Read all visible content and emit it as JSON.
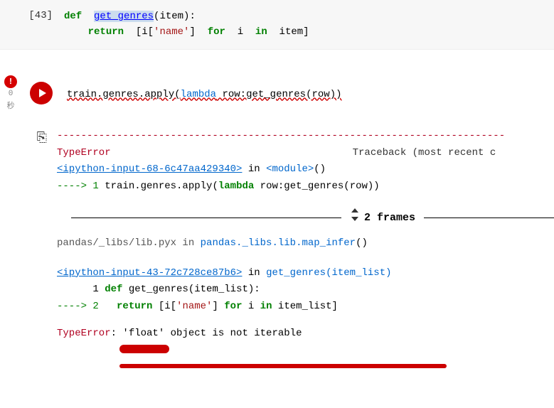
{
  "cell1": {
    "prompt": "[43]",
    "line1_def": "def",
    "line1_fn": "get_genres",
    "line1_args": "(item):",
    "line2_indent": "    ",
    "line2_return": "return",
    "line2_rest1": "  [i[",
    "line2_str": "'name'",
    "line2_rest2": "]  ",
    "line2_for": "for",
    "line2_rest3": "  i  ",
    "line2_in": "in",
    "line2_rest4": "  item]"
  },
  "exec": {
    "badge": "!",
    "sec1": "0",
    "sec2": "秒",
    "code_pre": "train.genres.apply(",
    "code_lambda": "lambda",
    "code_mid": "  row:get_genres(row))"
  },
  "tb": {
    "dashes": "---------------------------------------------------------------------------",
    "type_error": "TypeError",
    "traceback_label": "Traceback (most recent c",
    "link1": "<ipython-input-68-6c47aa429340>",
    "in_module": " in ",
    "module_txt": "<module>",
    "parens": "()",
    "arrow_line": "----> 1 train.genres.apply(",
    "arrow_lambda": "lambda",
    "arrow_rest": " row:get_genres(row))",
    "frames_count": "2 frames",
    "pandas_line_a": "pandas/_libs/lib.pyx in ",
    "pandas_line_b": "pandas._libs.lib.map_infer",
    "pandas_line_c": "()",
    "link2": "<ipython-input-43-72c728ce87b6>",
    "in2": " in ",
    "fn2": "get_genres(item_list)",
    "line_def_num": "      1 ",
    "line_def_kw": "def",
    "line_def_rest": " get_genres(item_list):",
    "line_ret_arrow": "----> 2   ",
    "line_ret_kw": "return",
    "line_ret_rest1": " [i[",
    "line_ret_str": "'name'",
    "line_ret_rest2": "] ",
    "line_ret_for": "for",
    "line_ret_rest3": " i ",
    "line_ret_in": "in",
    "line_ret_rest4": " item_list]",
    "final_label": "TypeError",
    "final_msg": ": 'float' object is not iterable"
  }
}
